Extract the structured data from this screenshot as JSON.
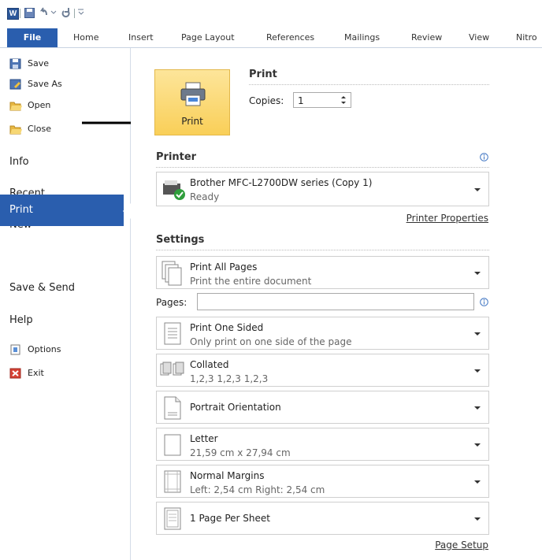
{
  "qat": {
    "word_letter": "W"
  },
  "tabs": [
    "File",
    "Home",
    "Insert",
    "Page Layout",
    "References",
    "Mailings",
    "Review",
    "View",
    "Nitro"
  ],
  "left_menu": {
    "save": "Save",
    "save_as": "Save As",
    "open": "Open",
    "close": "Close",
    "info": "Info",
    "recent": "Recent",
    "new": "New",
    "print": "Print",
    "save_send": "Save & Send",
    "help": "Help",
    "options": "Options",
    "exit": "Exit"
  },
  "print": {
    "heading": "Print",
    "button_label": "Print",
    "copies_label": "Copies:",
    "copies_value": "1"
  },
  "printer": {
    "heading": "Printer",
    "name": "Brother MFC-L2700DW series (Copy 1)",
    "status": "Ready",
    "properties_link": "Printer Properties"
  },
  "settings": {
    "heading": "Settings",
    "pages_label": "Pages:",
    "pages_value": "",
    "items": [
      {
        "title": "Print All Pages",
        "subtitle": "Print the entire document",
        "icon": "pages-icon"
      },
      {
        "title": "Print One Sided",
        "subtitle": "Only print on one side of the page",
        "icon": "one-sided-icon"
      },
      {
        "title": "Collated",
        "subtitle": "1,2,3   1,2,3   1,2,3",
        "icon": "collated-icon"
      },
      {
        "title": "Portrait Orientation",
        "subtitle": "",
        "icon": "portrait-icon"
      },
      {
        "title": "Letter",
        "subtitle": "21,59 cm x 27,94 cm",
        "icon": "paper-size-icon"
      },
      {
        "title": "Normal Margins",
        "subtitle": "Left:  2,54 cm   Right:  2,54 cm",
        "icon": "margins-icon"
      },
      {
        "title": "1 Page Per Sheet",
        "subtitle": "",
        "icon": "pages-per-sheet-icon"
      }
    ],
    "page_setup_link": "Page Setup"
  },
  "colors": {
    "accent": "#2a5eae",
    "print_button": "#f9cf58"
  }
}
